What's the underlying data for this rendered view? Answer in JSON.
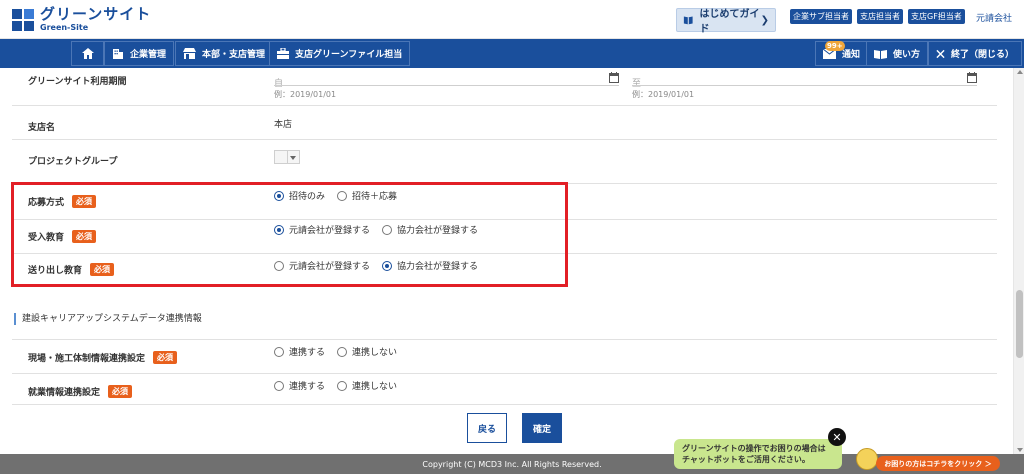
{
  "header": {
    "logo_text": "グリーンサイト",
    "logo_sub": "Green-Site",
    "guide_button": "はじめてガイド",
    "roles": [
      "企業サブ担当者",
      "支店担当者",
      "支店GF担当者"
    ],
    "company": "元請会社"
  },
  "nav": {
    "home_icon": "home-icon",
    "items": [
      "企業管理",
      "本部・支店管理",
      "支店グリーンファイル担当"
    ],
    "notice_label": "通知",
    "notice_count": "99+",
    "howto_label": "使い方",
    "exit_label": "終了（閉じる）"
  },
  "form": {
    "period_label": "グリーンサイト利用期間",
    "period_from_placeholder": "自",
    "period_to_placeholder": "至",
    "period_example": "例：2019/01/01",
    "branch_label": "支店名",
    "branch_value": "本店",
    "project_group_label": "プロジェクトグループ",
    "required_label": "必須",
    "application_label": "応募方式",
    "application_options": [
      "招待のみ",
      "招待＋応募"
    ],
    "application_selected": 0,
    "intake_label": "受入教育",
    "intake_options": [
      "元請会社が登録する",
      "協力会社が登録する"
    ],
    "intake_selected": 0,
    "sendoff_label": "送り出し教育",
    "sendoff_options": [
      "元請会社が登録する",
      "協力会社が登録する"
    ],
    "sendoff_selected": 1
  },
  "ccus": {
    "section_title": "建設キャリアアップシステムデータ連携情報",
    "site_label": "現場・施工体制情報連携設定",
    "employment_label": "就業情報連携設定",
    "options": [
      "連携する",
      "連携しない"
    ]
  },
  "footer": {
    "back_label": "戻る",
    "confirm_label": "確定",
    "copyright": "Copyright (C) MCD3 Inc. All Rights Reserved."
  },
  "chat": {
    "line1": "グリーンサイトの操作でお困りの場合は",
    "line2": "チャットボットをご活用ください。",
    "link_label": "お困りの方はコチラをクリック ＞",
    "close": "✕"
  },
  "colors": {
    "brand_blue": "#1a4f9c",
    "required_orange": "#e8601c",
    "highlight_red": "#e21f26"
  }
}
